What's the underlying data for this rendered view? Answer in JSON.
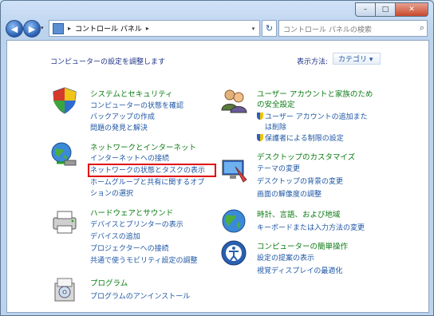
{
  "window": {
    "buttons": {
      "minimize": "–",
      "maximize": "□",
      "close": "✕"
    }
  },
  "nav": {
    "back_glyph": "◀",
    "forward_glyph": "▶",
    "dropdown_glyph": "▾",
    "address_sep": "▸",
    "address_text": "コントロール パネル",
    "address_sep2": "▸",
    "refresh_glyph": "↻",
    "search_placeholder": "コントロール パネルの検索",
    "search_glyph": "⌕"
  },
  "header": {
    "heading": "コンピューターの設定を調整します",
    "view_by_label": "表示方法:",
    "view_by_value": "カテゴリ ▾"
  },
  "categories": [
    {
      "title": "システムとセキュリティ",
      "links": [
        "コンピューターの状態を確認",
        "バックアップの作成",
        "問題の発見と解決"
      ]
    },
    {
      "title": "ネットワークとインターネット",
      "links": [
        "インターネットへの接続",
        "ネットワークの状態とタスクの表示",
        "ホームグループと共有に関するオプ",
        "ションの選択"
      ]
    },
    {
      "title": "ハードウェアとサウンド",
      "links": [
        "デバイスとプリンターの表示",
        "デバイスの追加",
        "プロジェクターへの接続",
        "共通で使うモビリティ設定の調整"
      ]
    },
    {
      "title": "プログラム",
      "links": [
        "プログラムのアンインストール"
      ]
    },
    {
      "title_line1": "ユーザー アカウントと家族のため",
      "title_line2": "の安全設定",
      "links": [
        "ユーザー アカウントの追加また",
        "は削除",
        "保護者による制限の設定"
      ]
    },
    {
      "title": "デスクトップのカスタマイズ",
      "links": [
        "テーマの変更",
        "デスクトップの背景の変更",
        "画面の解像度の調整"
      ]
    },
    {
      "title": "時計、言語、および地域",
      "links": [
        "キーボードまたは入力方法の変更"
      ]
    },
    {
      "title": "コンピューターの簡単操作",
      "links": [
        "設定の提案の表示",
        "視覚ディスプレイの最適化"
      ]
    }
  ],
  "colors": {
    "category_title": "#0d7c15",
    "link": "#1e56a4",
    "highlight": "#e00000",
    "heading": "#1e3287"
  }
}
